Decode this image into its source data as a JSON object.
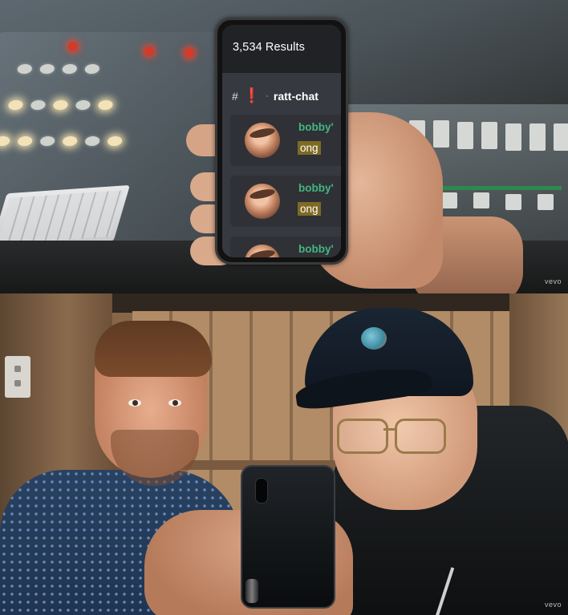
{
  "top_panel": {
    "phone_screen": {
      "results_count": "3,534 Results",
      "channel": {
        "hash": "#",
        "alert": "❗",
        "separator": "·",
        "name": "ratt-chat"
      },
      "messages": [
        {
          "username": "bobby'",
          "text": "ong"
        },
        {
          "username": "bobby'",
          "text": "ong"
        },
        {
          "username": "bobby'",
          "text": ""
        }
      ]
    },
    "watermark": "vevo"
  },
  "bottom_panel": {
    "watermark": "vevo"
  },
  "colors": {
    "discord_background": "#36393f",
    "discord_header": "#202225",
    "username_green": "#43b581",
    "highlight": "#7f6a24",
    "alert_red": "#e03b3b"
  }
}
